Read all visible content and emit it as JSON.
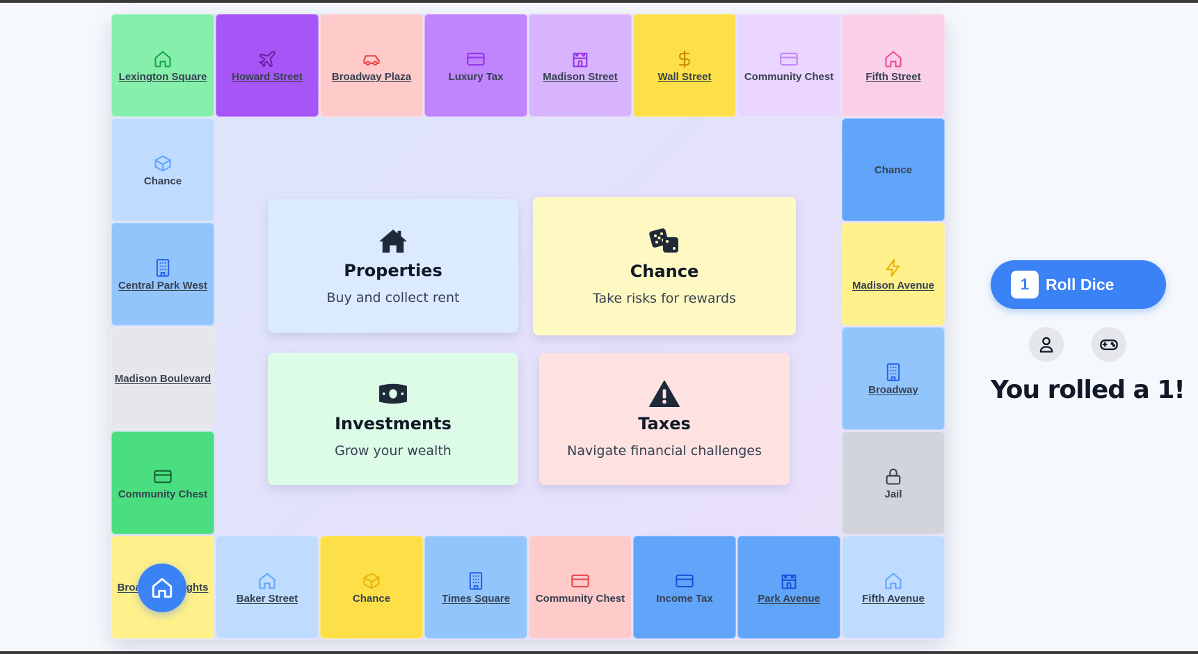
{
  "board": {
    "tiles": [
      {
        "label": "Lexington Square",
        "icon": "house-icon",
        "bg": "#86efac",
        "fg": "#16a34a",
        "link": true
      },
      {
        "label": "Howard Street",
        "icon": "plane-icon",
        "bg": "#a855f7",
        "fg": "#6b21a8",
        "link": true
      },
      {
        "label": "Broadway Plaza",
        "icon": "car-icon",
        "bg": "#fecaca",
        "fg": "#ef4444",
        "link": true
      },
      {
        "label": "Luxury Tax",
        "icon": "credit-card-icon",
        "bg": "#c084fc",
        "fg": "#9333ea",
        "link": false
      },
      {
        "label": "Madison Street",
        "icon": "castle-icon",
        "bg": "#d8b4fe",
        "fg": "#9333ea",
        "link": true
      },
      {
        "label": "Wall Street",
        "icon": "dollar-icon",
        "bg": "#fde047",
        "fg": "#ca8a04",
        "link": true
      },
      {
        "label": "Community Chest",
        "icon": "credit-card-icon",
        "bg": "#e9d5ff",
        "fg": "#c084fc",
        "link": false
      },
      {
        "label": "Fifth Street",
        "icon": "house-icon",
        "bg": "#fbcfe8",
        "fg": "#ec4899",
        "link": true
      },
      {
        "label": "Chance",
        "icon": "box-icon",
        "bg": "#bfdbfe",
        "fg": "#60a5fa",
        "link": false
      },
      {
        "label": "Chance",
        "icon": "",
        "bg": "#60a5fa",
        "fg": "#1e3a8a",
        "link": false
      },
      {
        "label": "Central Park West",
        "icon": "building-icon",
        "bg": "#93c5fd",
        "fg": "#2563eb",
        "link": true
      },
      {
        "label": "Madison Avenue",
        "icon": "lightning-icon",
        "bg": "#fef08a",
        "fg": "#eab308",
        "link": true
      },
      {
        "label": "Madison Boulevard",
        "icon": "",
        "bg": "#e5e7eb",
        "fg": "#374151",
        "link": true
      },
      {
        "label": "Broadway",
        "icon": "building-icon",
        "bg": "#93c5fd",
        "fg": "#2563eb",
        "link": true
      },
      {
        "label": "Community Chest",
        "icon": "credit-card-icon",
        "bg": "#4ade80",
        "fg": "#166534",
        "link": false
      },
      {
        "label": "Jail",
        "icon": "lock-icon",
        "bg": "#d1d5db",
        "fg": "#374151",
        "link": false
      },
      {
        "label": "Broadway Heights",
        "icon": "",
        "bg": "#fef08a",
        "fg": "#374151",
        "link": true
      },
      {
        "label": "Baker Street",
        "icon": "house-icon",
        "bg": "#bfdbfe",
        "fg": "#60a5fa",
        "link": true
      },
      {
        "label": "Chance",
        "icon": "box-icon",
        "bg": "#fde047",
        "fg": "#eab308",
        "link": false
      },
      {
        "label": "Times Square",
        "icon": "building-icon",
        "bg": "#93c5fd",
        "fg": "#2563eb",
        "link": true
      },
      {
        "label": "Community Chest",
        "icon": "credit-card-icon",
        "bg": "#fecaca",
        "fg": "#ef4444",
        "link": false
      },
      {
        "label": "Income Tax",
        "icon": "credit-card-icon",
        "bg": "#60a5fa",
        "fg": "#1d4ed8",
        "link": false
      },
      {
        "label": "Park Avenue",
        "icon": "castle-icon",
        "bg": "#60a5fa",
        "fg": "#1d4ed8",
        "link": true
      },
      {
        "label": "Fifth Avenue",
        "icon": "house-icon",
        "bg": "#bfdbfe",
        "fg": "#60a5fa",
        "link": true
      }
    ]
  },
  "cards": [
    {
      "title": "Properties",
      "desc": "Buy and collect rent",
      "icon": "house-icon",
      "bg": "#dbeafe"
    },
    {
      "title": "Chance",
      "desc": "Take risks for rewards",
      "icon": "dice-icon",
      "bg": "#fef9c3"
    },
    {
      "title": "Investments",
      "desc": "Grow your wealth",
      "icon": "money-icon",
      "bg": "#dcfce7"
    },
    {
      "title": "Taxes",
      "desc": "Navigate financial challenges",
      "icon": "warning-icon",
      "bg": "#fee2e2"
    }
  ],
  "controls": {
    "die_value": "1",
    "roll_label": "Roll Dice",
    "rolled_text": "You rolled a 1!",
    "accent": "#3b82f6"
  }
}
